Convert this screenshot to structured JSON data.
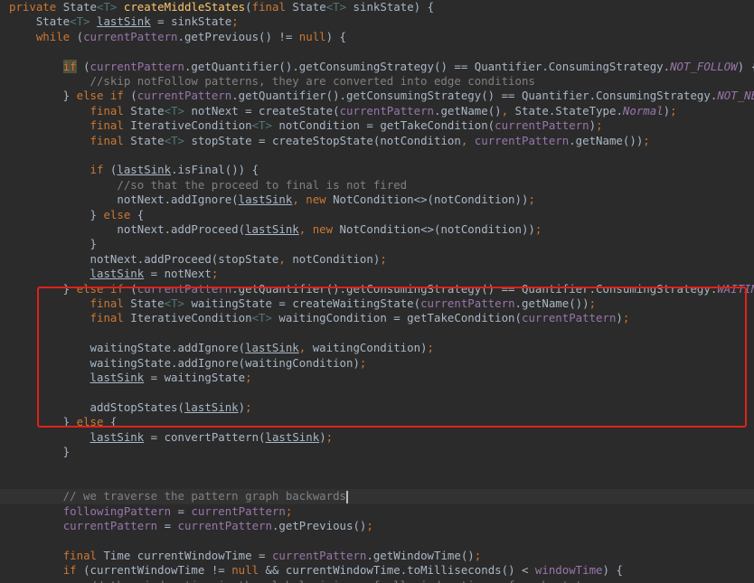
{
  "editor": {
    "lines": [
      [
        [
          "k",
          "private "
        ],
        [
          "d",
          "State"
        ],
        [
          "g",
          "<T>"
        ],
        [
          "d",
          " "
        ],
        [
          "f",
          "createMiddleStates"
        ],
        [
          "d",
          "("
        ],
        [
          "k",
          "final "
        ],
        [
          "d",
          "State"
        ],
        [
          "g",
          "<T>"
        ],
        [
          "d",
          " sinkState) {"
        ]
      ],
      [
        [
          "d",
          "    State"
        ],
        [
          "g",
          "<T>"
        ],
        [
          "d",
          " "
        ],
        [
          "du",
          "lastSink"
        ],
        [
          "d",
          " = sinkState"
        ],
        [
          "k",
          ";"
        ]
      ],
      [
        [
          "d",
          "    "
        ],
        [
          "k",
          "while "
        ],
        [
          "d",
          "("
        ],
        [
          "v",
          "currentPattern"
        ],
        [
          "d",
          ".getPrevious() != "
        ],
        [
          "k",
          "null"
        ],
        [
          "d",
          ") {"
        ]
      ],
      [
        [
          "d",
          ""
        ]
      ],
      [
        [
          "d",
          "        "
        ],
        [
          "w",
          "if"
        ],
        [
          "d",
          " ("
        ],
        [
          "v",
          "currentPattern"
        ],
        [
          "d",
          ".getQuantifier().getConsumingStrategy() == Quantifier.ConsumingStrategy."
        ],
        [
          "s",
          "NOT_FOLLOW"
        ],
        [
          "d",
          ") {"
        ]
      ],
      [
        [
          "c",
          "            //skip notFollow patterns, they are converted into edge conditions"
        ]
      ],
      [
        [
          "d",
          "        } "
        ],
        [
          "k",
          "else if "
        ],
        [
          "d",
          "("
        ],
        [
          "v",
          "currentPattern"
        ],
        [
          "d",
          ".getQuantifier().getConsumingStrategy() == Quantifier.ConsumingStrategy."
        ],
        [
          "s",
          "NOT_NEXT"
        ],
        [
          "d",
          ") {"
        ]
      ],
      [
        [
          "d",
          "            "
        ],
        [
          "k",
          "final "
        ],
        [
          "d",
          "State"
        ],
        [
          "g",
          "<T>"
        ],
        [
          "d",
          " notNext = createState("
        ],
        [
          "v",
          "currentPattern"
        ],
        [
          "d",
          ".getName()"
        ],
        [
          "k",
          ", "
        ],
        [
          "d",
          "State.StateType."
        ],
        [
          "s",
          "Normal"
        ],
        [
          "d",
          ")"
        ],
        [
          "k",
          ";"
        ]
      ],
      [
        [
          "d",
          "            "
        ],
        [
          "k",
          "final "
        ],
        [
          "d",
          "IterativeCondition"
        ],
        [
          "g",
          "<T>"
        ],
        [
          "d",
          " notCondition = getTakeCondition("
        ],
        [
          "v",
          "currentPattern"
        ],
        [
          "d",
          ")"
        ],
        [
          "k",
          ";"
        ]
      ],
      [
        [
          "d",
          "            "
        ],
        [
          "k",
          "final "
        ],
        [
          "d",
          "State"
        ],
        [
          "g",
          "<T>"
        ],
        [
          "d",
          " stopState = createStopState(notCondition"
        ],
        [
          "k",
          ", "
        ],
        [
          "v",
          "currentPattern"
        ],
        [
          "d",
          ".getName())"
        ],
        [
          "k",
          ";"
        ]
      ],
      [
        [
          "d",
          ""
        ]
      ],
      [
        [
          "d",
          "            "
        ],
        [
          "k",
          "if "
        ],
        [
          "d",
          "("
        ],
        [
          "du",
          "lastSink"
        ],
        [
          "d",
          ".isFinal()) {"
        ]
      ],
      [
        [
          "c",
          "                //so that the proceed to final is not fired"
        ]
      ],
      [
        [
          "d",
          "                notNext.addIgnore("
        ],
        [
          "du",
          "lastSink"
        ],
        [
          "k",
          ", new "
        ],
        [
          "d",
          "NotCondition<>(notCondition))"
        ],
        [
          "k",
          ";"
        ]
      ],
      [
        [
          "d",
          "            } "
        ],
        [
          "k",
          "else "
        ],
        [
          "d",
          "{"
        ]
      ],
      [
        [
          "d",
          "                notNext.addProceed("
        ],
        [
          "du",
          "lastSink"
        ],
        [
          "k",
          ", new "
        ],
        [
          "d",
          "NotCondition<>(notCondition))"
        ],
        [
          "k",
          ";"
        ]
      ],
      [
        [
          "d",
          "            }"
        ]
      ],
      [
        [
          "d",
          "            notNext.addProceed(stopState"
        ],
        [
          "k",
          ", "
        ],
        [
          "d",
          "notCondition)"
        ],
        [
          "k",
          ";"
        ]
      ],
      [
        [
          "d",
          "            "
        ],
        [
          "du",
          "lastSink"
        ],
        [
          "d",
          " = notNext"
        ],
        [
          "k",
          ";"
        ]
      ],
      [
        [
          "d",
          "        } "
        ],
        [
          "k",
          "else if "
        ],
        [
          "d",
          "("
        ],
        [
          "v",
          "currentPattern"
        ],
        [
          "d",
          ".getQuantifier().getConsumingStrategy() == Quantifier.ConsumingStrategy."
        ],
        [
          "s",
          "WAITING"
        ],
        [
          "d",
          ") {"
        ]
      ],
      [
        [
          "d",
          "            "
        ],
        [
          "k",
          "final "
        ],
        [
          "d",
          "State"
        ],
        [
          "g",
          "<T>"
        ],
        [
          "d",
          " waitingState = createWaitingState("
        ],
        [
          "v",
          "currentPattern"
        ],
        [
          "d",
          ".getName())"
        ],
        [
          "k",
          ";"
        ]
      ],
      [
        [
          "d",
          "            "
        ],
        [
          "k",
          "final "
        ],
        [
          "d",
          "IterativeCondition"
        ],
        [
          "g",
          "<T>"
        ],
        [
          "d",
          " waitingCondition = getTakeCondition("
        ],
        [
          "v",
          "currentPattern"
        ],
        [
          "d",
          ")"
        ],
        [
          "k",
          ";"
        ]
      ],
      [
        [
          "d",
          ""
        ]
      ],
      [
        [
          "d",
          "            waitingState.addIgnore("
        ],
        [
          "du",
          "lastSink"
        ],
        [
          "k",
          ", "
        ],
        [
          "d",
          "waitingCondition)"
        ],
        [
          "k",
          ";"
        ]
      ],
      [
        [
          "d",
          "            waitingState.addIgnore(waitingCondition)"
        ],
        [
          "k",
          ";"
        ]
      ],
      [
        [
          "d",
          "            "
        ],
        [
          "du",
          "lastSink"
        ],
        [
          "d",
          " = waitingState"
        ],
        [
          "k",
          ";"
        ]
      ],
      [
        [
          "d",
          ""
        ]
      ],
      [
        [
          "d",
          "            addStopStates("
        ],
        [
          "du",
          "lastSink"
        ],
        [
          "d",
          ")"
        ],
        [
          "k",
          ";"
        ]
      ],
      [
        [
          "d",
          "        } "
        ],
        [
          "k",
          "else "
        ],
        [
          "d",
          "{"
        ]
      ],
      [
        [
          "d",
          "            "
        ],
        [
          "du",
          "lastSink"
        ],
        [
          "d",
          " = convertPattern("
        ],
        [
          "du",
          "lastSink"
        ],
        [
          "d",
          ")"
        ],
        [
          "k",
          ";"
        ]
      ],
      [
        [
          "d",
          "        }"
        ]
      ],
      [
        [
          "d",
          ""
        ]
      ],
      [
        [
          "d",
          ""
        ]
      ],
      [
        [
          "c",
          "        // we traverse the pattern graph backwards"
        ]
      ],
      [
        [
          "d",
          "        "
        ],
        [
          "v",
          "followingPattern"
        ],
        [
          "d",
          " = "
        ],
        [
          "v",
          "currentPattern"
        ],
        [
          "k",
          ";"
        ]
      ],
      [
        [
          "d",
          "        "
        ],
        [
          "v",
          "currentPattern"
        ],
        [
          "d",
          " = "
        ],
        [
          "v",
          "currentPattern"
        ],
        [
          "d",
          ".getPrevious()"
        ],
        [
          "k",
          ";"
        ]
      ],
      [
        [
          "d",
          ""
        ]
      ],
      [
        [
          "d",
          "        "
        ],
        [
          "k",
          "final "
        ],
        [
          "d",
          "Time currentWindowTime = "
        ],
        [
          "v",
          "currentPattern"
        ],
        [
          "d",
          ".getWindowTime()"
        ],
        [
          "k",
          ";"
        ]
      ],
      [
        [
          "d",
          "        "
        ],
        [
          "k",
          "if "
        ],
        [
          "d",
          "(currentWindowTime != "
        ],
        [
          "k",
          "null "
        ],
        [
          "d",
          "&& currentWindowTime.toMilliseconds() < "
        ],
        [
          "v",
          "windowTime"
        ],
        [
          "d",
          ") {"
        ]
      ],
      [
        [
          "c",
          "            // the window time is the global minimum of all window times of each state"
        ]
      ]
    ],
    "current_line": 33,
    "colors": {
      "background": "#2b2b2b",
      "default_text": "#a9b7c6",
      "keyword": "#cc7832",
      "method": "#ffc66d",
      "generic": "#507874",
      "field": "#9876aa",
      "comment": "#808080",
      "highlight_box": "#e0211b"
    }
  }
}
